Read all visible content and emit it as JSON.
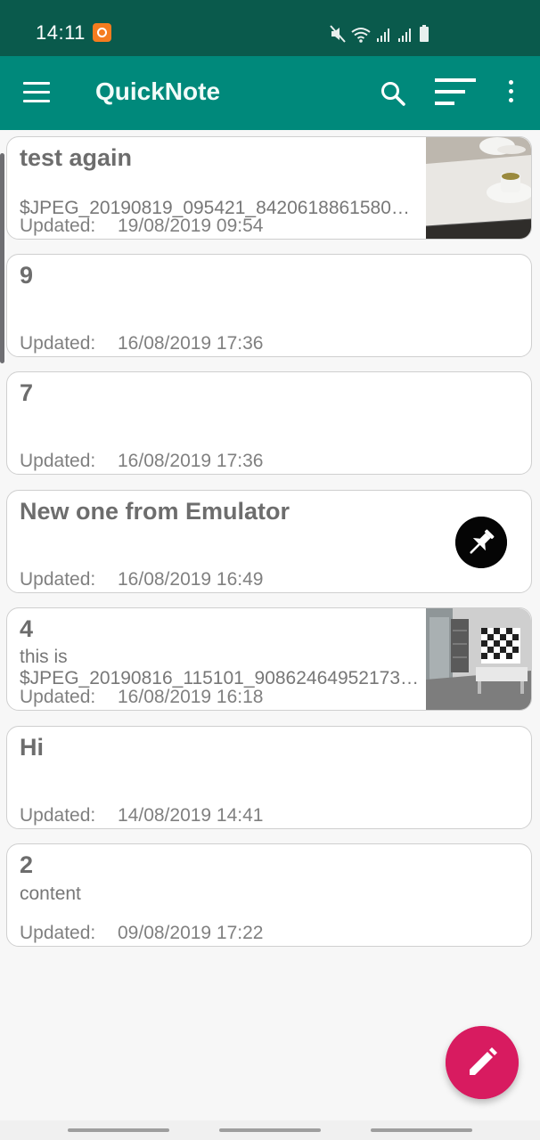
{
  "status_bar": {
    "time": "14:11"
  },
  "app_bar": {
    "title": "QuickNote"
  },
  "notes": [
    {
      "title": "test again",
      "content_lines": [
        "$JPEG_20190819_095421_8420618861580…"
      ],
      "updated_label": "Updated:",
      "updated_at": "19/08/2019 09:54",
      "has_image": true
    },
    {
      "title": "9",
      "content_lines": [],
      "updated_label": "Updated:",
      "updated_at": "16/08/2019 17:36"
    },
    {
      "title": "7",
      "content_lines": [],
      "updated_label": "Updated:",
      "updated_at": "16/08/2019 17:36"
    },
    {
      "title": "New one from Emulator",
      "content_lines": [],
      "updated_label": "Updated:",
      "updated_at": "16/08/2019 16:49",
      "pinned": true
    },
    {
      "title": "4",
      "content_lines": [
        "this is",
        "$JPEG_20190816_115101_90862464952173…"
      ],
      "updated_label": "Updated:",
      "updated_at": "16/08/2019 16:18",
      "has_image": true
    },
    {
      "title": "Hi",
      "content_lines": [],
      "updated_label": "Updated:",
      "updated_at": "14/08/2019 14:41"
    },
    {
      "title": "2",
      "content_lines": [
        "content"
      ],
      "updated_label": "Updated:",
      "updated_at": "09/08/2019 17:22"
    }
  ],
  "colors": {
    "status_bar": "#0a5a4c",
    "app_bar": "#00897b",
    "fab": "#d81b60",
    "background": "#f7f7f7"
  },
  "icons": {
    "menu": "menu-icon",
    "search": "search-icon",
    "sort": "sort-icon",
    "more": "more-vert-icon",
    "pin": "pin-icon",
    "fab": "edit-pencil-icon"
  }
}
